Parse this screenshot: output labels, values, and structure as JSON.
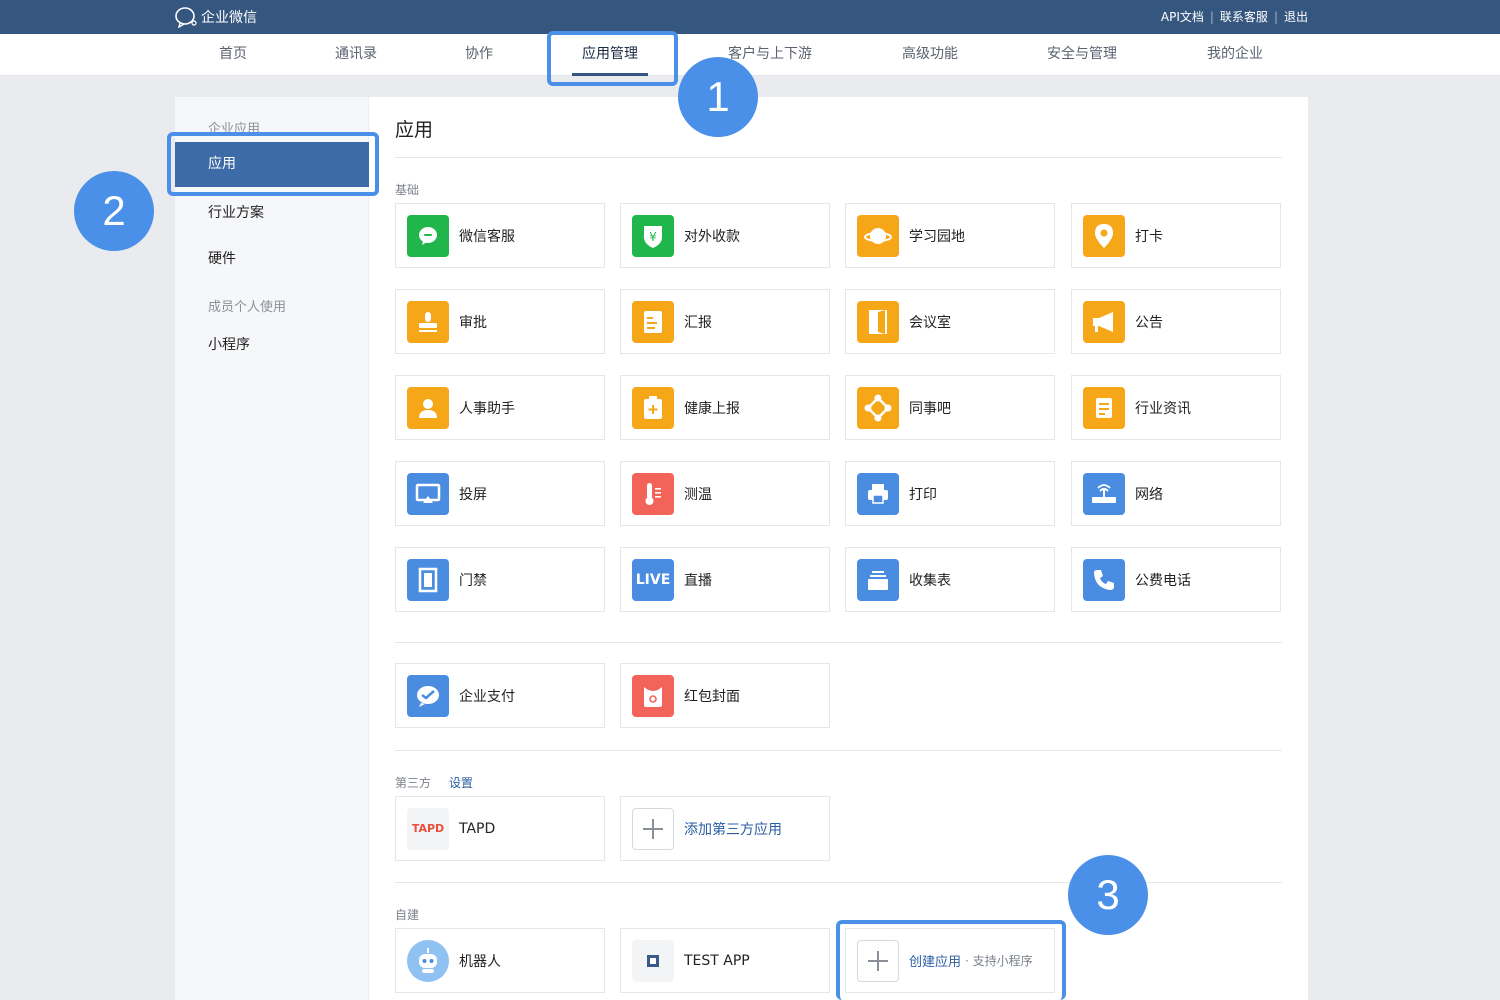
{
  "header": {
    "logo_text": "企业微信",
    "links": [
      "API文档",
      "联系客服",
      "退出"
    ]
  },
  "nav": {
    "items": [
      "首页",
      "通讯录",
      "协作",
      "应用管理",
      "客户与上下游",
      "高级功能",
      "安全与管理",
      "我的企业"
    ],
    "active_index": 3
  },
  "sidebar": {
    "group1": "企业应用",
    "active_item": "应用",
    "items": [
      "行业方案",
      "硬件"
    ],
    "group2": "成员个人使用",
    "items2": [
      "小程序"
    ]
  },
  "main": {
    "title": "应用",
    "basic_label": "基础",
    "basic_apps": [
      {
        "label": "微信客服",
        "icon": "chat-bubble-icon",
        "color": "green"
      },
      {
        "label": "对外收款",
        "icon": "yuan-shield-icon",
        "color": "green"
      },
      {
        "label": "学习园地",
        "icon": "planet-icon",
        "color": "orange"
      },
      {
        "label": "打卡",
        "icon": "location-pin-icon",
        "color": "orange"
      },
      {
        "label": "审批",
        "icon": "stamp-icon",
        "color": "orange"
      },
      {
        "label": "汇报",
        "icon": "report-doc-icon",
        "color": "orange"
      },
      {
        "label": "会议室",
        "icon": "door-icon",
        "color": "orange"
      },
      {
        "label": "公告",
        "icon": "megaphone-icon",
        "color": "orange"
      },
      {
        "label": "人事助手",
        "icon": "person-icon",
        "color": "orange"
      },
      {
        "label": "健康上报",
        "icon": "clipboard-plus-icon",
        "color": "orange"
      },
      {
        "label": "同事吧",
        "icon": "network-icon",
        "color": "orange"
      },
      {
        "label": "行业资讯",
        "icon": "news-icon",
        "color": "orange"
      },
      {
        "label": "投屏",
        "icon": "screen-cast-icon",
        "color": "blue"
      },
      {
        "label": "测温",
        "icon": "thermometer-icon",
        "color": "red"
      },
      {
        "label": "打印",
        "icon": "printer-icon",
        "color": "blue"
      },
      {
        "label": "网络",
        "icon": "router-icon",
        "color": "blue"
      },
      {
        "label": "门禁",
        "icon": "door-access-icon",
        "color": "blue"
      },
      {
        "label": "直播",
        "icon": "live-icon",
        "color": "blue",
        "icon_text": "LIVE"
      },
      {
        "label": "收集表",
        "icon": "stack-icon",
        "color": "blue"
      },
      {
        "label": "公费电话",
        "icon": "phone-icon",
        "color": "blue"
      }
    ],
    "pay_apps": [
      {
        "label": "企业支付",
        "icon": "pay-check-icon",
        "color": "blue"
      },
      {
        "label": "红包封面",
        "icon": "red-envelope-icon",
        "color": "red"
      }
    ],
    "third_label": "第三方",
    "third_link": "设置",
    "third_apps": [
      {
        "label": "TAPD",
        "icon": "tapd-logo-icon",
        "logo_text": "TAPD"
      },
      {
        "label": "添加第三方应用",
        "icon": "plus-icon"
      }
    ],
    "self_label": "自建",
    "self_apps": [
      {
        "label": "机器人",
        "icon": "robot-icon"
      },
      {
        "label": "TEST APP",
        "icon": "app-placeholder-icon"
      },
      {
        "label": "创建应用",
        "hint": "· 支持小程序",
        "icon": "plus-icon"
      }
    ]
  },
  "callouts": [
    "1",
    "2",
    "3"
  ],
  "colors": {
    "topbar": "#35567f",
    "accent": "#4a90e8",
    "sidebar_active": "#3d6ba8",
    "link": "#2a5ea3"
  }
}
